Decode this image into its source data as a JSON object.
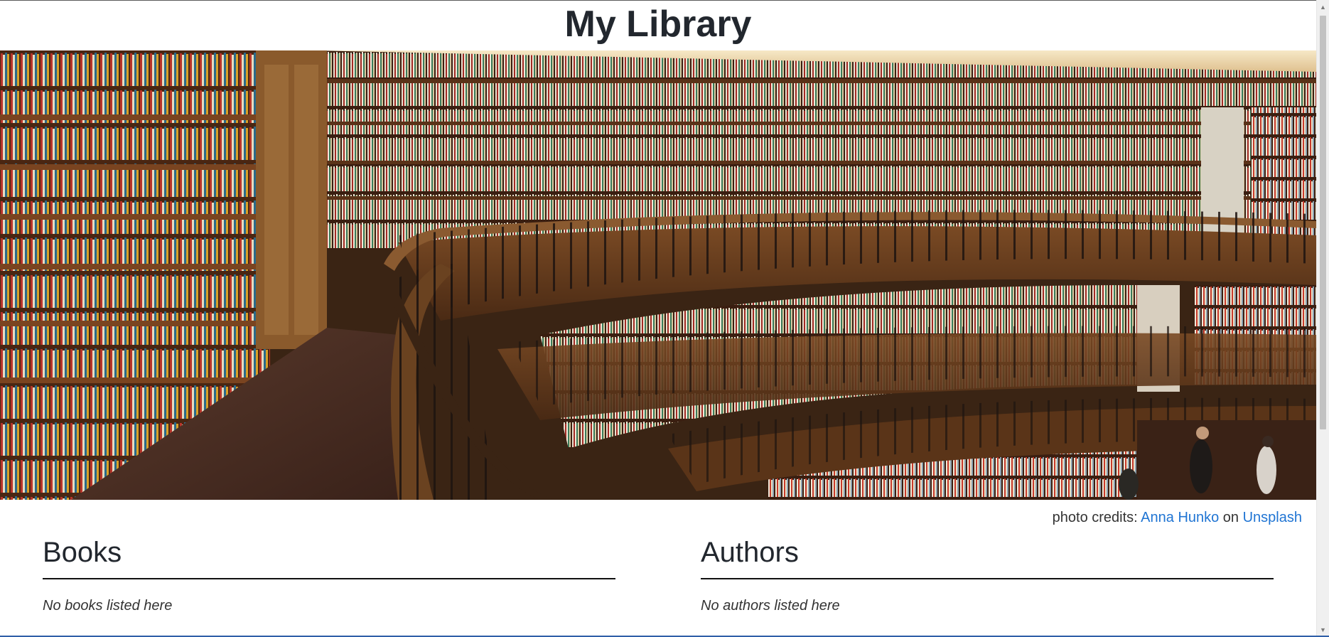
{
  "page": {
    "title": "My Library"
  },
  "hero": {
    "alt": "Circular library interior with curved bookshelves"
  },
  "credits": {
    "prefix": "photo credits: ",
    "author": "Anna Hunko",
    "connector": " on ",
    "site": "Unsplash"
  },
  "books": {
    "heading": "Books",
    "empty_text": "No books listed here"
  },
  "authors": {
    "heading": "Authors",
    "empty_text": "No authors listed here"
  },
  "colors": {
    "link": "#1f74d3",
    "text": "#22272e"
  }
}
